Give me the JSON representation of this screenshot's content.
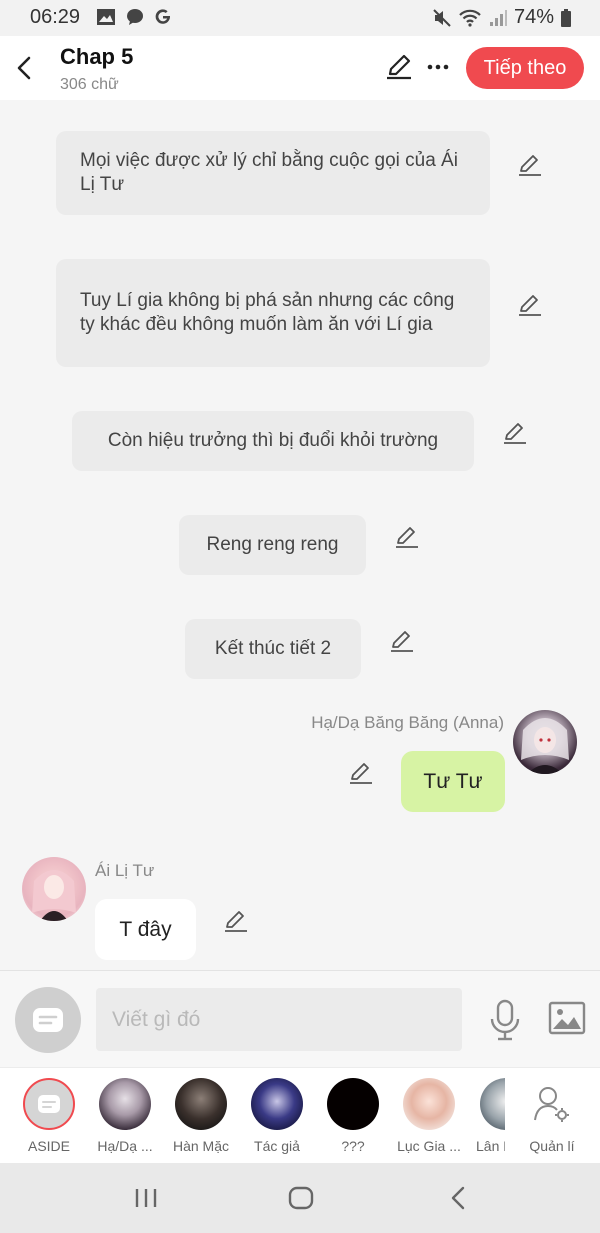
{
  "status_bar": {
    "time": "06:29",
    "battery": "74%"
  },
  "header": {
    "title": "Chap 5",
    "subtitle": "306 chữ",
    "next_label": "Tiếp theo"
  },
  "chat": {
    "narration": [
      "Mọi việc được xử lý chỉ bằng cuộc gọi của Ái Lị Tư",
      "Tuy Lí gia không bị phá sản nhưng các công ty khác đều không muốn làm ăn với Lí gia",
      "Còn hiệu trưởng thì bị đuổi khỏi trường",
      "Reng reng reng",
      "Kết thúc tiết 2"
    ],
    "messages": [
      {
        "speaker": "Hạ/Dạ Băng Băng (Anna)",
        "text": "Tư Tư",
        "side": "right"
      },
      {
        "speaker": "Ái Lị Tư",
        "text": "T đây",
        "side": "left"
      }
    ]
  },
  "composer": {
    "placeholder": "Viết gì đó"
  },
  "characters": [
    {
      "label": "ASIDE"
    },
    {
      "label": "Hạ/Dạ ..."
    },
    {
      "label": "Hàn Mặc"
    },
    {
      "label": "Tác giả"
    },
    {
      "label": "???"
    },
    {
      "label": "Lục Gia ..."
    },
    {
      "label": "Lân Hà"
    },
    {
      "label": "Quản lí"
    }
  ],
  "colors": {
    "accent": "#f04a4f",
    "bubble_right": "#d7f3a4",
    "bubble_left": "#ffffff",
    "narration_bg": "#ebebeb"
  }
}
